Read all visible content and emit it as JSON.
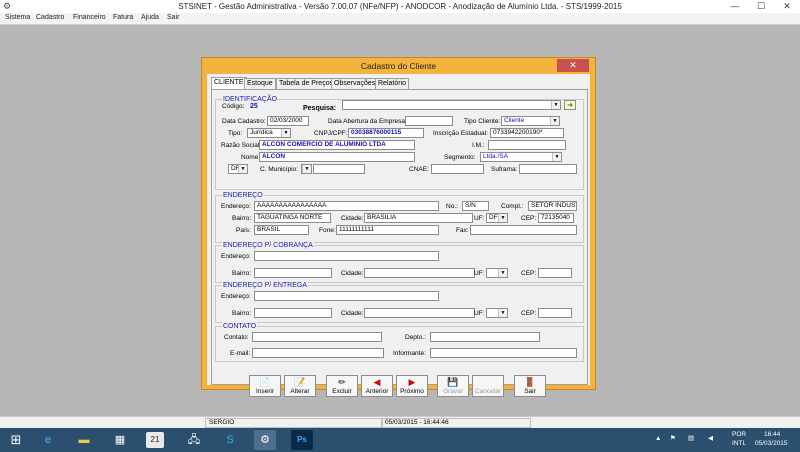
{
  "window": {
    "title": "STSINET - Gestão Administrativa - Versão 7.00.07 (NFe/NFP) - ANODCOR - Anodização de Alumínio Ltda. -  STS/1999-2015",
    "minimize": "—",
    "maximize": "☐",
    "close": "✕"
  },
  "menu": [
    "Sistema",
    "Cadastro",
    "Financeiro",
    "Fatura",
    "Ajuda",
    "Sair"
  ],
  "dialog": {
    "title": "Cadastro do Cliente",
    "close": "✕",
    "tabs": [
      "CLIENTE",
      "Estoque",
      "Tabela de Preços",
      "Observações",
      "Relatório"
    ],
    "identificacao": {
      "title": "IDENTIFICAÇÃO",
      "codigo_label": "Código:",
      "codigo_value": "25",
      "pesquisa_label": "Pesquisa:",
      "pesquisa_value": "",
      "data_cadastro_label": "Data Cadastro:",
      "data_cadastro_value": "02/03/2000",
      "data_abertura_label": "Data Abertura da Empresa:",
      "data_abertura_value": "",
      "tipo_cliente_label": "Tipo Cliente:",
      "tipo_cliente_value": "Cliente",
      "tipo_label": "Tipo:",
      "tipo_value": "Jurídica",
      "cnpj_label": "CNPJ/CPF:",
      "cnpj_value": "03038876000115",
      "ie_label": "Inscrição Estadual:",
      "ie_value": "0733942200190*",
      "razao_label": "Razão Social:",
      "razao_value": "ALCON COMERCIO DE ALUMINIO LTDA",
      "im_label": "I.M.:",
      "im_value": "",
      "nome_label": "Nome:",
      "nome_value": "ALCON",
      "segmento_label": "Segmento:",
      "segmento_value": "Ltda./SA",
      "uf_value": "DF",
      "municipio_label": "C. Município:",
      "municipio_value": "",
      "cnae_label": "CNAE:",
      "cnae_value": "",
      "suframa_label": "Suframa:",
      "suframa_value": ""
    },
    "endereco": {
      "title": "ENDEREÇO",
      "endereco_label": "Endereço:",
      "endereco_value": "AAAAAAAAAAAAAAAA",
      "no_label": "No.:",
      "no_value": "S/N",
      "compl_label": "Compl.:",
      "compl_value": "SETOR INDUSTR",
      "bairro_label": "Bairro:",
      "bairro_value": "TAGUATINGA NORTE",
      "cidade_label": "Cidade:",
      "cidade_value": "BRASILIA",
      "uf_label": "UF:",
      "uf_value": "DF",
      "cep_label": "CEP:",
      "cep_value": "72135040",
      "pais_label": "País:",
      "pais_value": "BRASIL",
      "fone_label": "Fone:",
      "fone_value": "11111111111",
      "fax_label": "Fax:",
      "fax_value": ""
    },
    "cobranca": {
      "title": "ENDEREÇO P/ COBRANÇA",
      "endereco_label": "Endereço:",
      "bairro_label": "Bairro:",
      "cidade_label": "Cidade:",
      "uf_label": "UF:",
      "cep_label": "CEP:"
    },
    "entrega": {
      "title": "ENDEREÇO P/ ENTREGA",
      "endereco_label": "Endereço:",
      "bairro_label": "Bairro:",
      "cidade_label": "Cidade:",
      "uf_label": "UF:",
      "cep_label": "CEP:"
    },
    "contato": {
      "title": "CONTATO",
      "contato_label": "Contato:",
      "depto_label": "Depto.:",
      "email_label": "E-mail:",
      "informante_label": "Informante:"
    },
    "buttons": {
      "inserir": "Inserir",
      "alterar": "Alterar",
      "excluir": "Excluir",
      "anterior": "Anterior",
      "proximo": "Próximo",
      "gravar": "Gravar",
      "cancelar": "Cancelar",
      "sair": "Sair"
    }
  },
  "statusbar": {
    "user": "SERGIO",
    "datetime": "05/03/2015  -  16:44:46"
  },
  "taskbar": {
    "lang": "POR",
    "layout": "INTL",
    "time": "16:44",
    "date": "05/03/2015",
    "calendar_day": "21",
    "ps_label": "Ps"
  }
}
